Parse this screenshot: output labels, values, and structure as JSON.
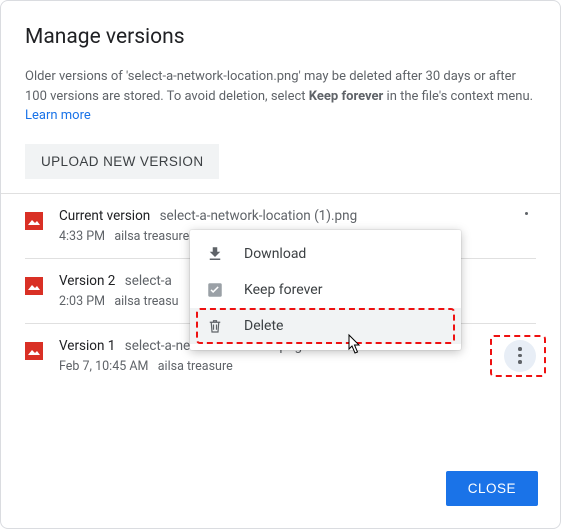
{
  "dialog": {
    "title": "Manage versions",
    "desc_pre": "Older versions of 'select-a-network-location.png' may be deleted after 30 days or after 100 versions are stored. To avoid deletion, select ",
    "desc_bold": "Keep forever",
    "desc_post": " in the file's context menu. ",
    "learn_more": "Learn more",
    "upload_label": "UPLOAD NEW VERSION",
    "close_label": "CLOSE"
  },
  "versions": [
    {
      "label": "Current version",
      "filename": "select-a-network-location (1).png",
      "time": "4:33 PM",
      "author": "ailsa treasure"
    },
    {
      "label": "Version 2",
      "filename": "select-a",
      "time": "2:03 PM",
      "author": "ailsa treasu"
    },
    {
      "label": "Version 1",
      "filename": "select-a-network-location.png",
      "time": "Feb 7, 10:45 AM",
      "author": "ailsa treasure"
    }
  ],
  "menu": {
    "download": "Download",
    "keep_forever": "Keep forever",
    "delete": "Delete"
  }
}
